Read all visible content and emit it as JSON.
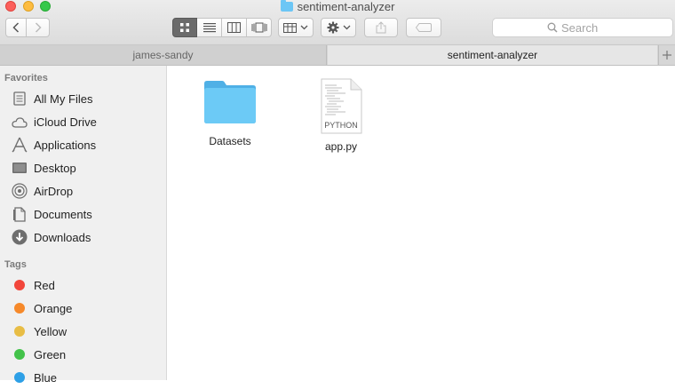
{
  "window": {
    "title": "sentiment-analyzer"
  },
  "toolbar": {
    "search_placeholder": "Search",
    "view_modes": [
      "icon",
      "list",
      "column",
      "cover-flow"
    ],
    "active_view": "icon"
  },
  "tabs": [
    {
      "label": "james-sandy",
      "active": false
    },
    {
      "label": "sentiment-analyzer",
      "active": true
    }
  ],
  "sidebar": {
    "favorites_header": "Favorites",
    "favorites": [
      {
        "label": "All My Files",
        "icon": "all-files-icon"
      },
      {
        "label": "iCloud Drive",
        "icon": "cloud-icon"
      },
      {
        "label": "Applications",
        "icon": "applications-icon"
      },
      {
        "label": "Desktop",
        "icon": "desktop-icon"
      },
      {
        "label": "AirDrop",
        "icon": "airdrop-icon"
      },
      {
        "label": "Documents",
        "icon": "documents-icon"
      },
      {
        "label": "Downloads",
        "icon": "downloads-icon"
      }
    ],
    "tags_header": "Tags",
    "tags": [
      {
        "label": "Red",
        "color": "#f2463b"
      },
      {
        "label": "Orange",
        "color": "#f6892a"
      },
      {
        "label": "Yellow",
        "color": "#e8bd45"
      },
      {
        "label": "Green",
        "color": "#43c24a"
      },
      {
        "label": "Blue",
        "color": "#2d9fe6"
      }
    ]
  },
  "files": [
    {
      "name": "Datasets",
      "kind": "folder",
      "icon": "folder-icon"
    },
    {
      "name": "app.py",
      "kind": "python",
      "icon": "python-file-icon",
      "badge": "PYTHON"
    }
  ],
  "colors": {
    "folder": "#5ac2f5",
    "selected_view": "#6b6b6b"
  }
}
